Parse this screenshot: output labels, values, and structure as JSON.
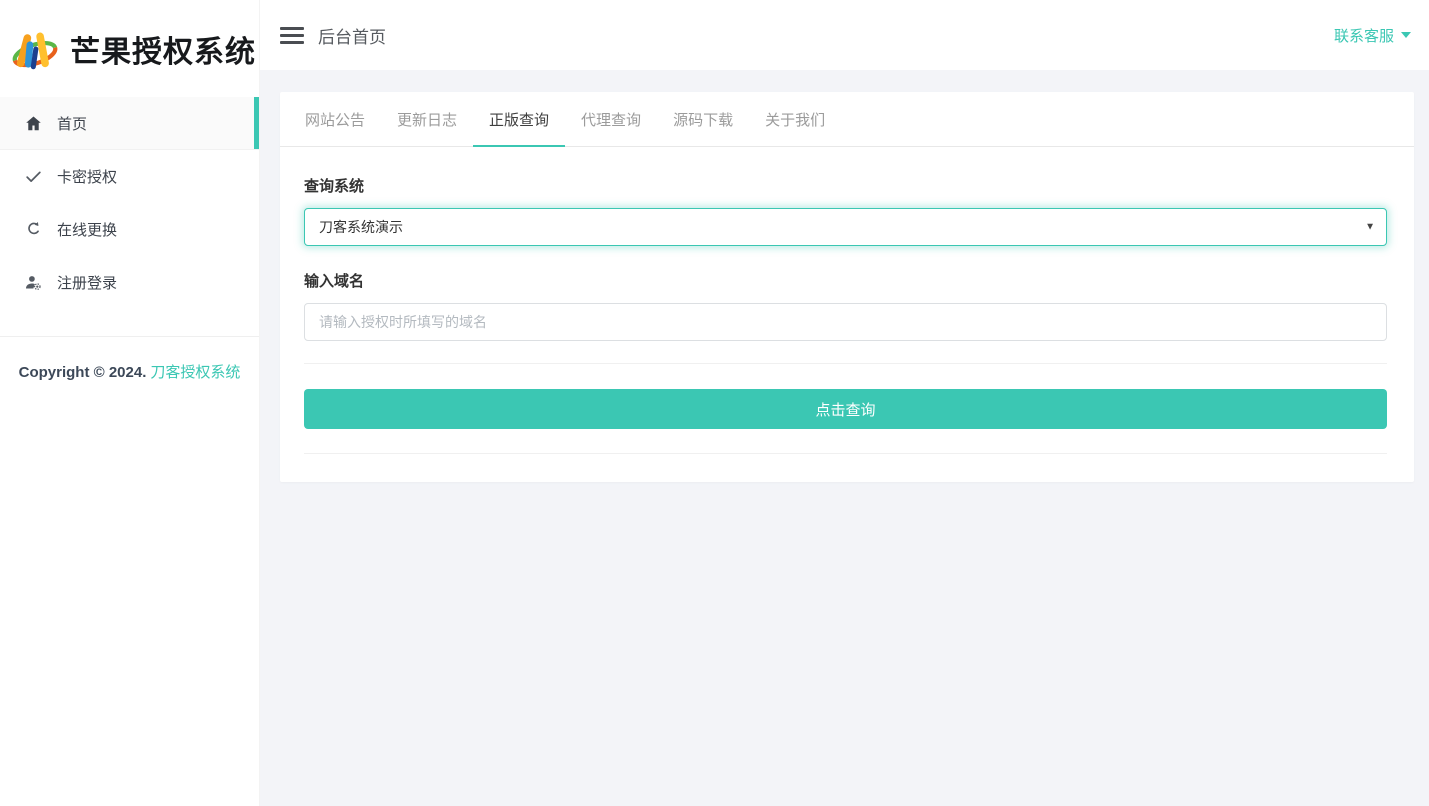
{
  "theme": {
    "accent": "#3bc7b3",
    "content_bg": "#f3f4f8",
    "active_tab_text": "#3f3f3f",
    "inactive_tab_text": "#9b9b9b"
  },
  "brand": {
    "title": "芒果授权系统"
  },
  "sidebar": {
    "items": [
      {
        "label": "首页",
        "icon": "home-icon",
        "active": true
      },
      {
        "label": "卡密授权",
        "icon": "check-icon",
        "active": false
      },
      {
        "label": "在线更换",
        "icon": "sync-icon",
        "active": false
      },
      {
        "label": "注册登录",
        "icon": "user-gear-icon",
        "active": false
      }
    ],
    "copyright": {
      "prefix": "Copyright © 2024.",
      "link": "刀客授权系统"
    }
  },
  "topbar": {
    "title": "后台首页",
    "contact": "联系客服"
  },
  "tabs": {
    "active_index": 2,
    "items": [
      {
        "label": "网站公告"
      },
      {
        "label": "更新日志"
      },
      {
        "label": "正版查询"
      },
      {
        "label": "代理查询"
      },
      {
        "label": "源码下载"
      },
      {
        "label": "关于我们"
      }
    ]
  },
  "form": {
    "system": {
      "label": "查询系统",
      "selected": "刀客系统演示"
    },
    "domain": {
      "label": "输入域名",
      "value": "",
      "placeholder": "请输入授权时所填写的域名"
    },
    "submit": "点击查询"
  },
  "icons": {
    "select_caret": "▼"
  }
}
